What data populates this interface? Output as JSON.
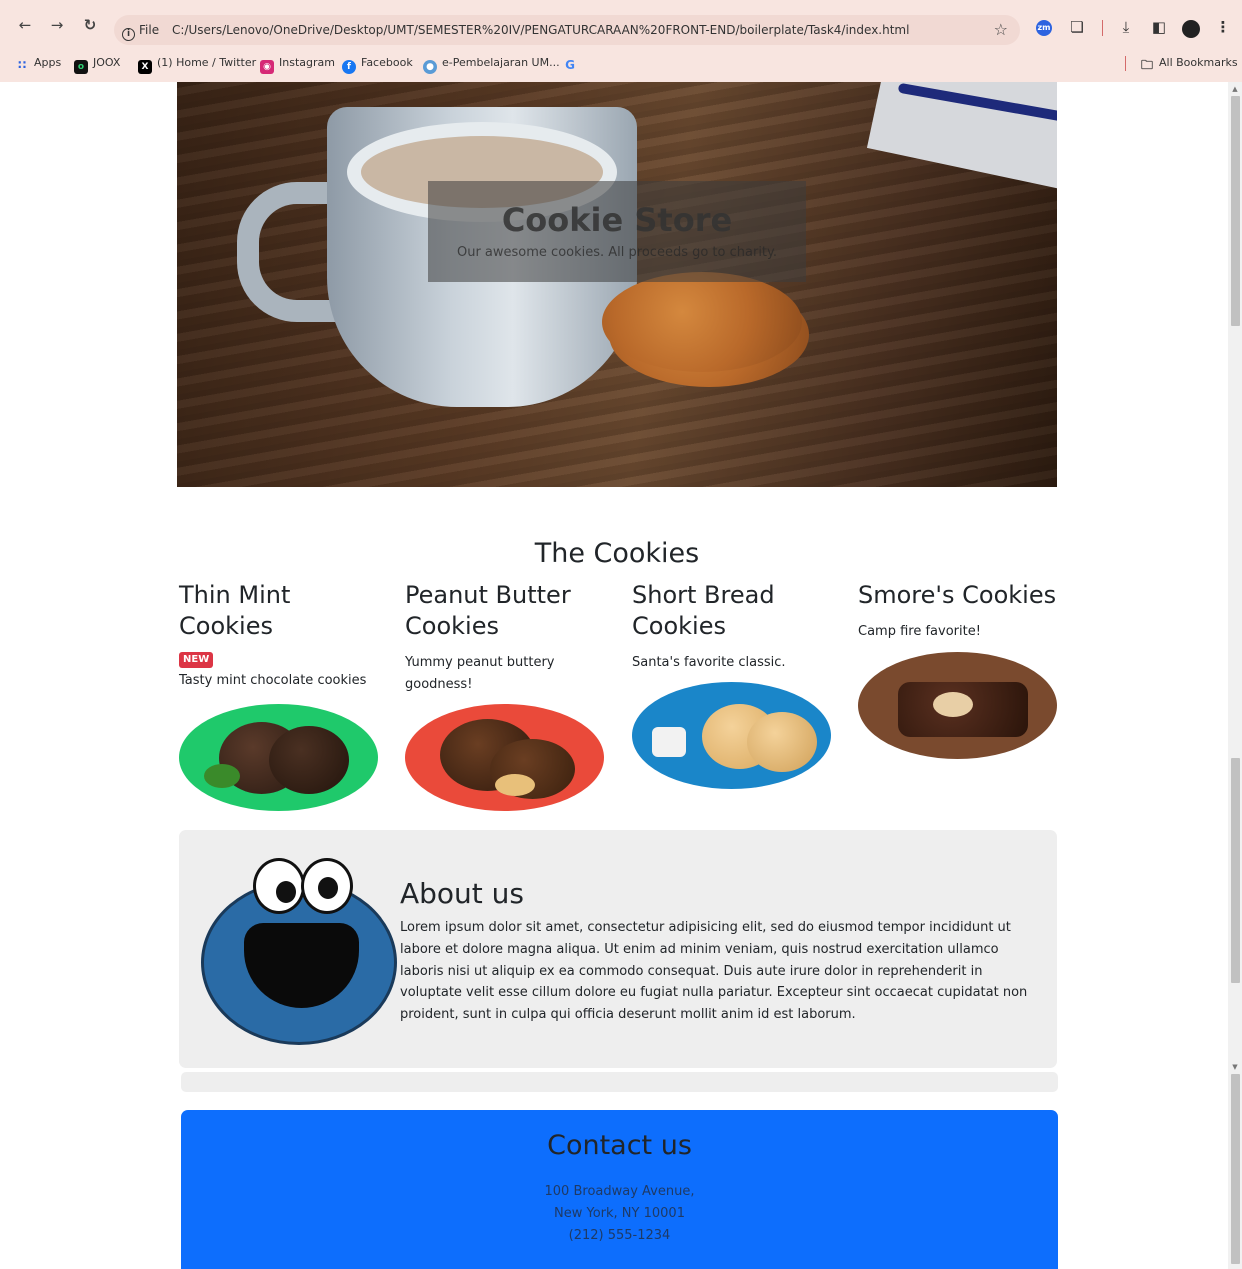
{
  "browser": {
    "file_label": "File",
    "url": "C:/Users/Lenovo/OneDrive/Desktop/UMT/SEMESTER%20IV/PENGATURCARAAN%20FRONT-END/boilerplate/Task4/index.html",
    "bookmarks": [
      {
        "label": "Apps",
        "icon": "apps-grid-icon"
      },
      {
        "label": "JOOX",
        "icon": "joox-icon"
      },
      {
        "label": "(1) Home / Twitter",
        "icon": "x-twitter-icon"
      },
      {
        "label": "Instagram",
        "icon": "instagram-icon"
      },
      {
        "label": "Facebook",
        "icon": "facebook-icon"
      },
      {
        "label": "e-Pembelajaran UM...",
        "icon": "globe-search-icon"
      },
      {
        "label": "",
        "icon": "google-icon"
      }
    ],
    "all_bookmarks": "All Bookmarks"
  },
  "hero": {
    "title": "Cookie Store",
    "subtitle": "Our awesome cookies. All proceeds go to charity."
  },
  "cookies": {
    "section_title": "The Cookies",
    "items": [
      {
        "title": "Thin Mint Cookies",
        "badge": "NEW",
        "desc": "Tasty mint chocolate cookies",
        "color": "#1fc96b"
      },
      {
        "title": "Peanut Butter Cookies",
        "badge": "",
        "desc": "Yummy peanut buttery goodness!",
        "color": "#ea4a3a"
      },
      {
        "title": "Short Bread Cookies",
        "badge": "",
        "desc": "Santa's favorite classic.",
        "color": "#1a86c9"
      },
      {
        "title": "Smore's Cookies",
        "badge": "",
        "desc": "Camp fire favorite!",
        "color": "#7a4a2e"
      }
    ]
  },
  "about": {
    "title": "About us",
    "text": "Lorem ipsum dolor sit amet, consectetur adipisicing elit, sed do eiusmod tempor incididunt ut labore et dolore magna aliqua. Ut enim ad minim veniam, quis nostrud exercitation ullamco laboris nisi ut aliquip ex ea commodo consequat. Duis aute irure dolor in reprehenderit in voluptate velit esse cillum dolore eu fugiat nulla pariatur. Excepteur sint occaecat cupidatat non proident, sunt in culpa qui officia deserunt mollit anim id est laborum."
  },
  "contact": {
    "title": "Contact us",
    "address1": "100 Broadway Avenue,",
    "address2": "New York, NY 10001",
    "phone": "(212) 555-1234"
  }
}
